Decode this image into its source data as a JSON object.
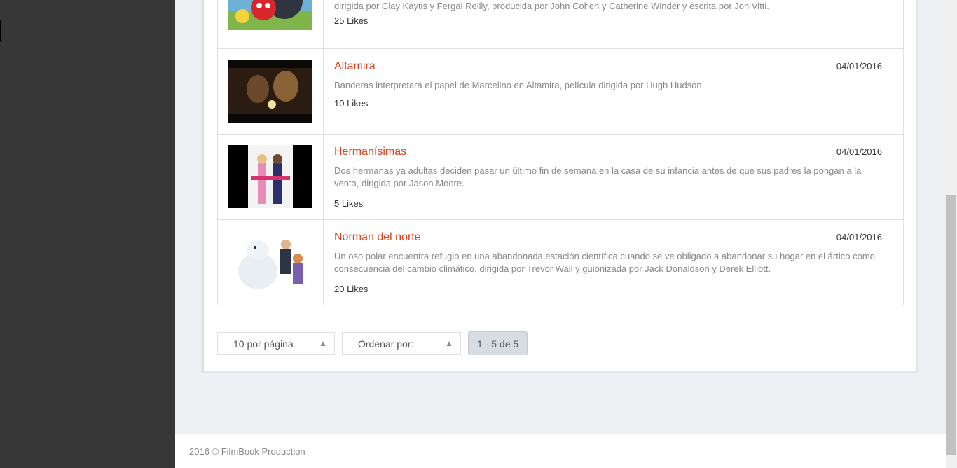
{
  "films": [
    {
      "title": "",
      "date": "",
      "description": "The Angry Birds Movie es una próxima película finlandés-estadounidense en 3D de animación por computadora y comedia de acción dirigida por Clay Kaytis y Fergal Reilly, producida por John Cohen y Catherine Winder y escrita por Jon Vitti.",
      "likes": "25 Likes",
      "thumb": "angry-birds-poster"
    },
    {
      "title": "Altamira",
      "date": "04/01/2016",
      "description": "Banderas interpretará el papel de Marcelino en Altamira, película dirigida por Hugh Hudson.",
      "likes": "10 Likes",
      "thumb": "altamira-poster"
    },
    {
      "title": "Hermanísimas",
      "date": "04/01/2016",
      "description": "Dos hermanas ya adultas deciden pasar un último fin de semana en la casa de su infancia antes de que sus padres la pongan a la venta, dirigida por Jason Moore.",
      "likes": "5 Likes",
      "thumb": "hermanisimas-poster"
    },
    {
      "title": "Norman del norte",
      "date": "04/01/2016",
      "description": "Un oso polar encuentra refugio en una abandonada estación científica cuando se ve obligado a abandonar su hogar en el ártico como consecuencia del cambio climático, dirigida por Trevor Wall y guionizada por Jack Donaldson y Derek Elliott.",
      "likes": "20 Likes",
      "thumb": "norman-poster"
    }
  ],
  "pager": {
    "per_page": "10 por página",
    "sort_label": "Ordenar por:",
    "range": "1 - 5 de 5"
  },
  "footer": {
    "text": "2016 © FilmBook Production"
  },
  "colors": {
    "accent": "#d9441f",
    "sidebar": "#373737"
  }
}
